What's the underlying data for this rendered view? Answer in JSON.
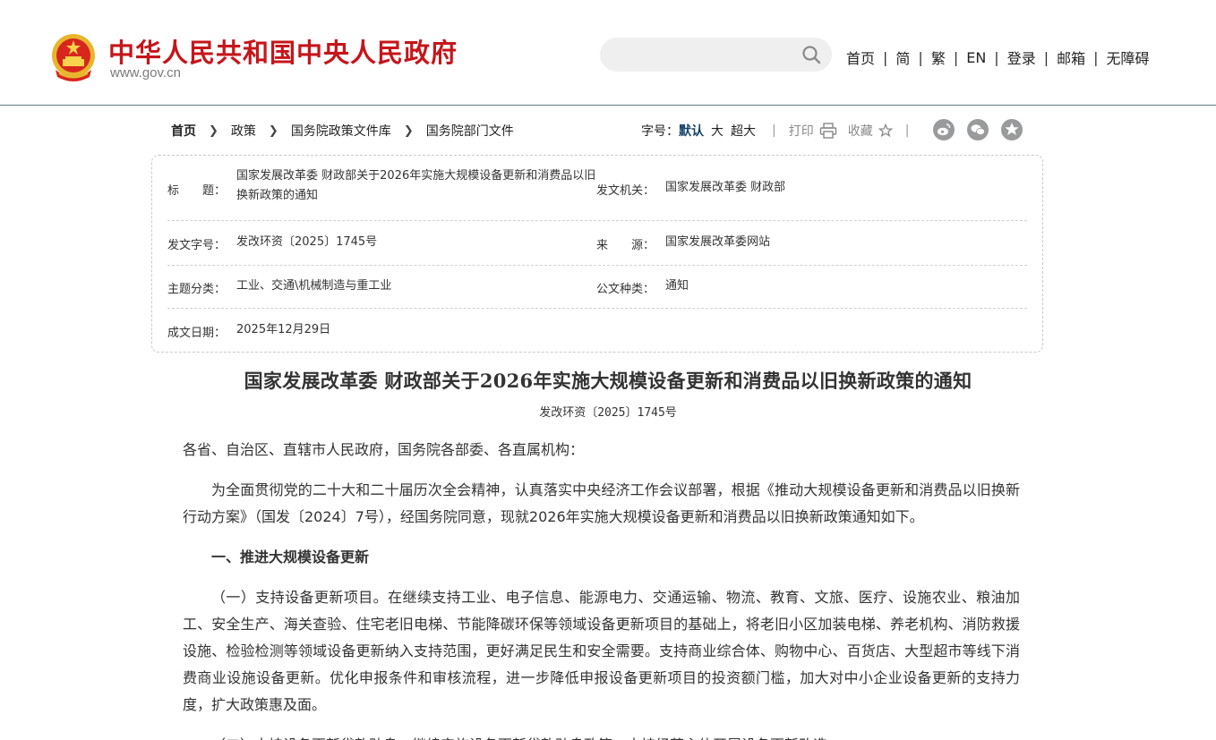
{
  "header": {
    "site_title": "中华人民共和国中央人民政府",
    "site_domain": "www.gov.cn",
    "search": {
      "value": "",
      "placeholder": ""
    },
    "nav": [
      {
        "label": "首页"
      },
      {
        "label": "简"
      },
      {
        "label": "繁"
      },
      {
        "label": "EN"
      },
      {
        "label": "登录"
      },
      {
        "label": "邮箱"
      },
      {
        "label": "无障碍"
      }
    ],
    "separator": "|"
  },
  "breadcrumb": [
    "首页",
    "政策",
    "国务院政策文件库",
    "国务院部门文件"
  ],
  "tools": {
    "font_size_label": "字号：",
    "font_sizes": [
      "默认",
      "大",
      "超大"
    ],
    "active_font_size": "默认",
    "print_label": "打印",
    "favorite_label": "收藏",
    "share_icons": [
      "weibo-icon",
      "wechat-icon",
      "qzone-icon"
    ]
  },
  "meta": {
    "title_label": "标　　题：",
    "title_value": "国家发展改革委 财政部关于2026年实施大规模设备更新和消费品以旧换新政策的通知",
    "issuer_label": "发文机关：",
    "issuer_value": "国家发展改革委 财政部",
    "doc_no_label": "发文字号：",
    "doc_no_value": "发改环资〔2025〕1745号",
    "source_label": "来　　源：",
    "source_value": "国家发展改革委网站",
    "topic_label": "主题分类：",
    "topic_value": "工业、交通\\机械制造与重工业",
    "type_label": "公文种类：",
    "type_value": "通知",
    "date_label": "成文日期：",
    "date_value": "2025年12月29日"
  },
  "article": {
    "title": "国家发展改革委 财政部关于2026年实施大规模设备更新和消费品以旧换新政策的通知",
    "doc_number": "发改环资〔2025〕1745号",
    "salutation": "各省、自治区、直辖市人民政府，国务院各部委、各直属机构：",
    "intro": "为全面贯彻党的二十大和二十届历次全会精神，认真落实中央经济工作会议部署，根据《推动大规模设备更新和消费品以旧换新行动方案》（国发〔2024〕7号），经国务院同意，现就2026年实施大规模设备更新和消费品以旧换新政策通知如下。",
    "section1_heading": "一、推进大规模设备更新",
    "section1_p1": "（一）支持设备更新项目。在继续支持工业、电子信息、能源电力、交通运输、物流、教育、文旅、医疗、设施农业、粮油加工、安全生产、海关查验、住宅老旧电梯、节能降碳环保等领域设备更新项目的基础上，将老旧小区加装电梯、养老机构、消防救援设施、检验检测等领域设备更新纳入支持范围，更好满足民生和安全需要。支持商业综合体、购物中心、百货店、大型超市等线下消费商业设施设备更新。优化申报条件和审核流程，进一步降低申报设备更新项目的投资额门槛，加大对中小企业设备更新的支持力度，扩大政策惠及面。",
    "section1_p2": "（二）支持设备更新贷款贴息。继续实施设备更新贷款贴息政策，支持经营主体开展设备更新改造。"
  },
  "colors": {
    "brand_red": "#c4161b",
    "header_rule": "#5f7a86",
    "active_font": "#14426b",
    "share_icon_bg": "#999a9b"
  }
}
